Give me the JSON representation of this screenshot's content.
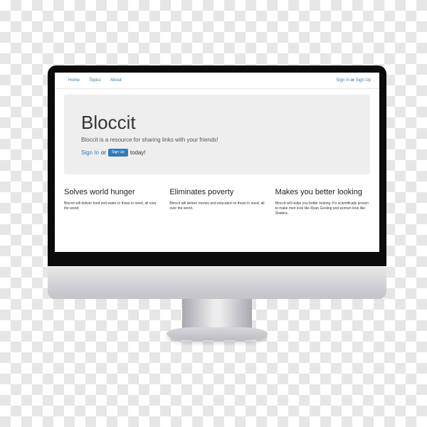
{
  "nav": {
    "links": [
      "Home",
      "Topics",
      "About"
    ],
    "sign_in": "Sign In",
    "or": "or",
    "sign_up": "Sign Up"
  },
  "jumbotron": {
    "title": "Bloccit",
    "lead": "Bloccit is a resource for sharing links with your friends!",
    "sign_in": "Sign In",
    "or": "or",
    "sign_up_button": "Sign Up",
    "today": "today!"
  },
  "features": [
    {
      "title": "Solves world hunger",
      "text": "Bloccit will deliver food and water to those in need, all over the world."
    },
    {
      "title": "Eliminates poverty",
      "text": "Bloccit will deliver money and education to those in need, all over the world."
    },
    {
      "title": "Makes you better looking",
      "text": "Bloccit will make you better looking. It's scientifically proven to make men look like Ryan Gosling and women look like Shakira."
    }
  ],
  "colors": {
    "link": "#337ab7",
    "jumbotron_bg": "#eeeeee",
    "bezel": "#0b0b0b",
    "chin": "#d2d2d6"
  }
}
